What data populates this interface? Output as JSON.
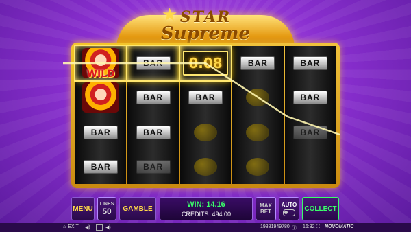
{
  "logo": {
    "line1": "STAR",
    "line2": "Supreme"
  },
  "reels": {
    "win_amount_on_reel": "0.08",
    "wild_label": "WILD",
    "bar_label": "BAR"
  },
  "panel": {
    "menu_label": "MENU",
    "lines_label": "LINES",
    "lines_value": "50",
    "gamble_label": "GAMBLE",
    "win_label": "WIN: 14.16",
    "credits_label": "CREDITS: 494.00",
    "max_bet_line1": "MAX",
    "max_bet_line2": "BET",
    "auto_label": "AUTO",
    "collect_label": "COLLECT"
  },
  "status_bar": {
    "exit_label": "EXIT",
    "session_id": "19381949780",
    "time": "16:32",
    "brand": "NOVOMATIC"
  },
  "colors": {
    "background": "#8a2fd0",
    "frame_gold": "#f0c23c",
    "win_green": "#3aff6a",
    "highlight": "#ffe770"
  },
  "icons": [
    "home-icon",
    "sound-icon",
    "info-icon",
    "clock-icon",
    "fullscreen-icon"
  ]
}
